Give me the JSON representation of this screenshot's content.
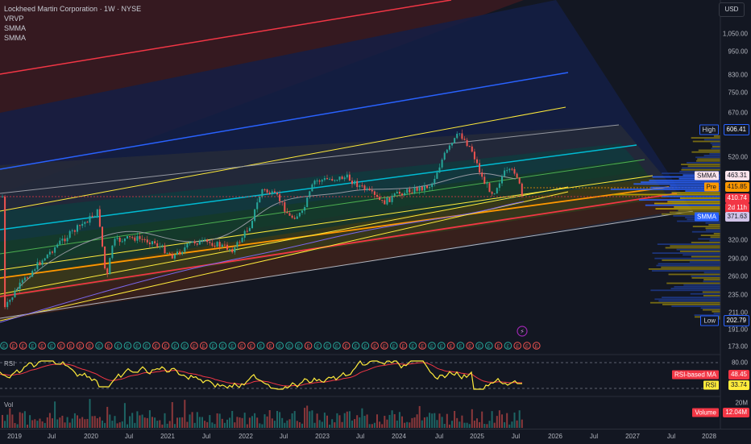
{
  "chart_title": "Lockheed Martin Corporation · 1W · NYSE",
  "indicators": [
    "VRVP",
    "SMMA",
    "SMMA"
  ],
  "currency": "USD",
  "price_axis": {
    "ticks": [
      "1,050.00",
      "950.00",
      "830.00",
      "750.00",
      "670.00",
      "520.00",
      "320.00",
      "290.00",
      "260.00",
      "235.00",
      "211.00",
      "191.00",
      "173.00"
    ],
    "high_label": "High",
    "high_value": "606.41",
    "low_label": "Low",
    "low_value": "202.79",
    "smma1_label": "SMMA",
    "smma1_value": "463.31",
    "pre_label": "Pre",
    "pre_value": "415.85",
    "last_value": "410.74",
    "countdown": "2d 11h",
    "smma2_label": "SMMA",
    "smma2_value": "371.63"
  },
  "rsi": {
    "pane_label": "RSI",
    "level_80": "80.00",
    "ma_label": "RSI-based MA",
    "ma_value": "48.45",
    "rsi_label": "RSI",
    "rsi_value": "33.74"
  },
  "volume": {
    "pane_label": "Vol",
    "level": "20M",
    "label": "Volume",
    "value": "12.04M"
  },
  "time_axis": [
    "2019",
    "Jul",
    "2020",
    "Jul",
    "2021",
    "Jul",
    "2022",
    "Jul",
    "2023",
    "Jul",
    "2024",
    "Jul",
    "2025",
    "Jul",
    "2026",
    "Jul",
    "2027",
    "Jul",
    "2028"
  ],
  "event_marker": "E",
  "colors": {
    "background": "#131722",
    "up": "#26a69a",
    "down": "#ef5350",
    "price_line": "#f23645",
    "smma_fast": "#2962ff",
    "smma_slow": "#7b68ee",
    "channel_yellow": "#ffeb3b",
    "channel_cyan": "#00bcd4",
    "channel_red": "#f23645",
    "rsi_line": "#ffeb3b",
    "rsi_ma": "#f23645",
    "volume_profile": "#2962ff"
  }
}
